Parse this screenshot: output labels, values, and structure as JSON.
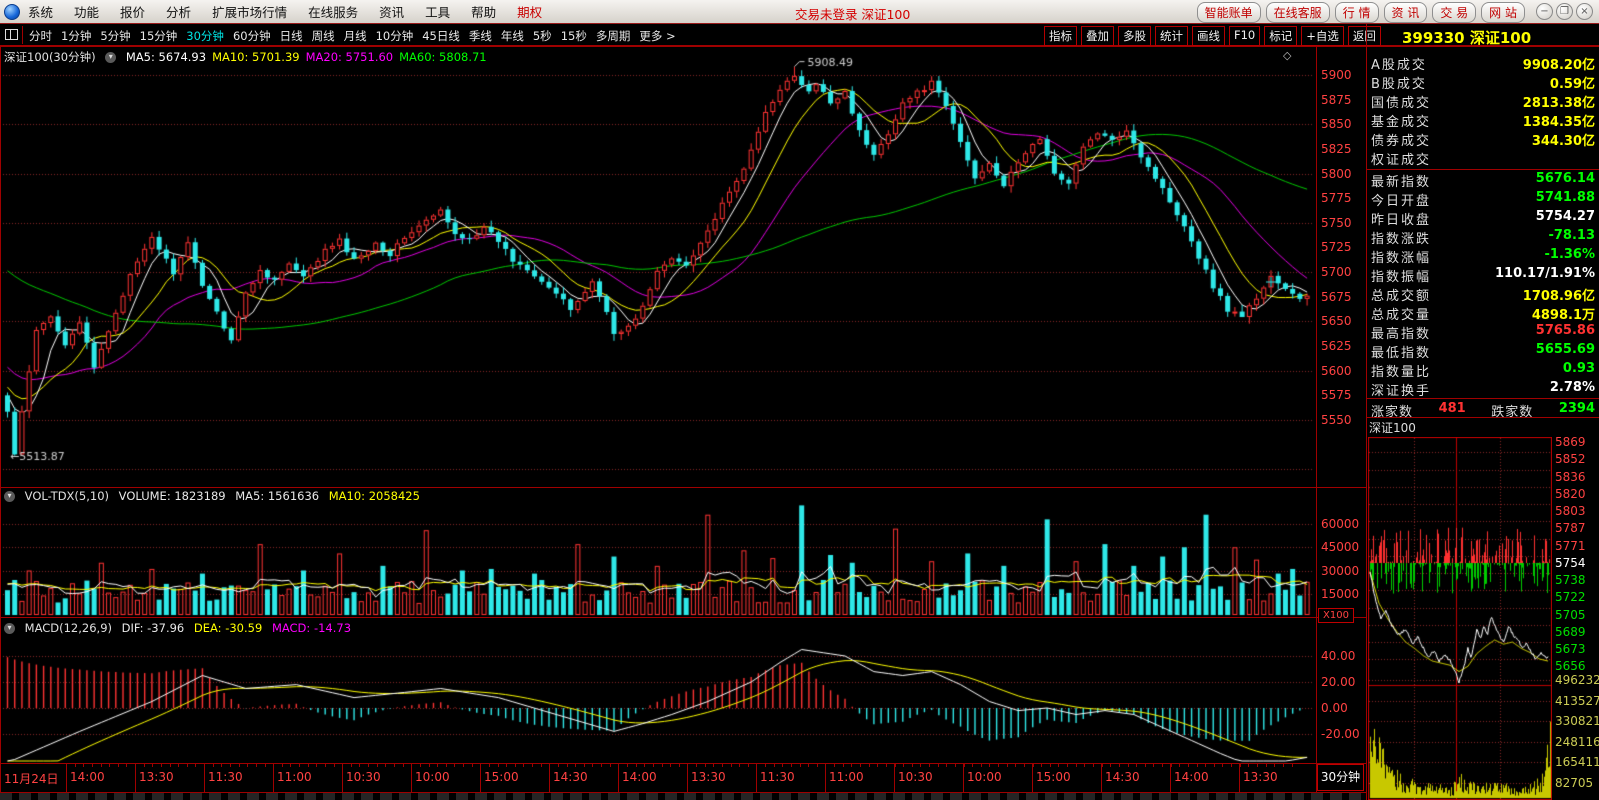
{
  "window": {
    "title_center": "交易未登录 深证100"
  },
  "menubar": {
    "items": [
      "系统",
      "功能",
      "报价",
      "分析",
      "扩展市场行情",
      "在线服务",
      "资讯",
      "工具",
      "帮助"
    ],
    "highlight_item": "期权",
    "action_buttons": [
      "智能账单",
      "在线客服",
      "行 情",
      "资 讯",
      "交 易",
      "网 站"
    ],
    "window_controls": [
      "−",
      "❐",
      "×"
    ]
  },
  "toolbar": {
    "periods": [
      "分时",
      "1分钟",
      "5分钟",
      "15分钟",
      "30分钟",
      "60分钟",
      "日线",
      "周线",
      "月线",
      "10分钟",
      "45日线",
      "季线",
      "年线",
      "5秒",
      "15秒",
      "多周期",
      "更多 >"
    ],
    "active_period": "30分钟",
    "tools": [
      "指标",
      "叠加",
      "多股",
      "统计",
      "画线",
      "F10",
      "标记",
      "+自选",
      "返回"
    ],
    "symbol_code": "399330",
    "symbol_name": "深证100"
  },
  "price_pane": {
    "title": "深证100(30分钟)",
    "mas": [
      {
        "label": "MA5: 5674.93",
        "color": "#ffffff"
      },
      {
        "label": "MA10: 5701.39",
        "color": "#ffff00"
      },
      {
        "label": "MA20: 5751.60",
        "color": "#ff00ff"
      },
      {
        "label": "MA60: 5808.71",
        "color": "#00ff00"
      }
    ],
    "axis": [
      "5900",
      "5875",
      "5850",
      "5825",
      "5800",
      "5775",
      "5750",
      "5725",
      "5700",
      "5675",
      "5650",
      "5625",
      "5600",
      "5575",
      "5550"
    ],
    "corner_icon": "◇"
  },
  "volume_pane": {
    "title": "VOL-TDX(5,10)",
    "volume_label": "VOLUME: 1823189",
    "ma5_label": "MA5: 1561636",
    "ma10_label": "MA10: 2058425",
    "axis": [
      "60000",
      "45000",
      "30000",
      "15000"
    ],
    "unit": "X100"
  },
  "macd_pane": {
    "title": "MACD(12,26,9)",
    "dif_label": "DIF: -37.96",
    "dea_label": "DEA: -30.59",
    "macd_label": "MACD: -14.73",
    "axis": [
      "40.00",
      "20.00",
      "0.00",
      "-20.00"
    ]
  },
  "time_axis": {
    "date": "11月24日",
    "labels": [
      "14:00",
      "13:30",
      "11:30",
      "11:00",
      "10:30",
      "10:00",
      "15:00",
      "14:30",
      "14:00",
      "13:30",
      "11:30",
      "11:00",
      "10:30",
      "10:00",
      "15:00",
      "14:30",
      "14:00",
      "13:30"
    ],
    "period_label": "30分钟"
  },
  "right_panel": {
    "section1": [
      {
        "label": "A股成交",
        "value": "9908.20亿",
        "color": "#ffff00"
      },
      {
        "label": "B股成交",
        "value": "0.59亿",
        "color": "#ffff00"
      },
      {
        "label": "国债成交",
        "value": "2813.38亿",
        "color": "#ffff00"
      },
      {
        "label": "基金成交",
        "value": "1384.35亿",
        "color": "#ffff00"
      },
      {
        "label": "债券成交",
        "value": "344.30亿",
        "color": "#ffff00"
      },
      {
        "label": "权证成交",
        "value": "",
        "color": "#ffff00"
      }
    ],
    "section2": [
      {
        "label": "最新指数",
        "value": "5676.14",
        "color": "#00ff00"
      },
      {
        "label": "今日开盘",
        "value": "5741.88",
        "color": "#00ff00"
      },
      {
        "label": "昨日收盘",
        "value": "5754.27",
        "color": "#ffffff"
      },
      {
        "label": "指数涨跌",
        "value": "-78.13",
        "color": "#00ff00"
      },
      {
        "label": "指数涨幅",
        "value": "-1.36%",
        "color": "#00ff00"
      },
      {
        "label": "指数振幅",
        "value": "110.17/1.91%",
        "color": "#ffffff"
      },
      {
        "label": "总成交额",
        "value": "1708.96亿",
        "color": "#ffff00"
      },
      {
        "label": "总成交量",
        "value": "4898.1万",
        "color": "#ffff00"
      },
      {
        "label": "最高指数",
        "value": "5765.86",
        "color": "#ff3232"
      },
      {
        "label": "最低指数",
        "value": "5655.69",
        "color": "#00ff00"
      },
      {
        "label": "指数量比",
        "value": "0.93",
        "color": "#00ff00"
      },
      {
        "label": "深证换手",
        "value": "2.78%",
        "color": "#ffffff"
      }
    ],
    "adv_label": "涨家数",
    "adv_value": "481",
    "dec_label": "跌家数",
    "dec_value": "2394",
    "mini_title": "深证100"
  },
  "colors": {
    "up": "#ff3232",
    "down": "#2ee8e8",
    "grid": "#8b2525",
    "frame": "#a00000",
    "ma5": "#ffffff",
    "ma10": "#ffff00",
    "ma20": "#e000e0",
    "ma60": "#00c800",
    "axis_text": "#ff4242",
    "mini_vol": "#c8c800"
  },
  "chart_data": {
    "type": "candlestick",
    "symbol": "深证100",
    "period": "30分钟",
    "ma_values": {
      "MA5": 5674.93,
      "MA10": 5701.39,
      "MA20": 5751.6,
      "MA60": 5808.71
    },
    "price_axis": [
      5900,
      5875,
      5850,
      5825,
      5800,
      5775,
      5750,
      5725,
      5700,
      5675,
      5650,
      5625,
      5600,
      5575,
      5550
    ],
    "high_annotation": 5908.49,
    "low_annotation": 5513.87,
    "last_close": 5676.14,
    "n_candles": 181,
    "close_waypoints": [
      [
        0,
        5558
      ],
      [
        1,
        5515
      ],
      [
        4,
        5640
      ],
      [
        6,
        5655
      ],
      [
        8,
        5628
      ],
      [
        10,
        5650
      ],
      [
        12,
        5602
      ],
      [
        15,
        5660
      ],
      [
        17,
        5696
      ],
      [
        19,
        5722
      ],
      [
        20,
        5736
      ],
      [
        23,
        5700
      ],
      [
        25,
        5728
      ],
      [
        27,
        5688
      ],
      [
        30,
        5645
      ],
      [
        31,
        5632
      ],
      [
        33,
        5678
      ],
      [
        35,
        5702
      ],
      [
        37,
        5692
      ],
      [
        39,
        5708
      ],
      [
        41,
        5694
      ],
      [
        44,
        5722
      ],
      [
        46,
        5732
      ],
      [
        48,
        5712
      ],
      [
        51,
        5730
      ],
      [
        53,
        5718
      ],
      [
        55,
        5736
      ],
      [
        58,
        5752
      ],
      [
        60,
        5762
      ],
      [
        62,
        5738
      ],
      [
        64,
        5735
      ],
      [
        66,
        5744
      ],
      [
        68,
        5732
      ],
      [
        70,
        5712
      ],
      [
        72,
        5704
      ],
      [
        74,
        5692
      ],
      [
        76,
        5678
      ],
      [
        78,
        5662
      ],
      [
        81,
        5690
      ],
      [
        83,
        5662
      ],
      [
        84,
        5636
      ],
      [
        86,
        5644
      ],
      [
        88,
        5665
      ],
      [
        90,
        5700
      ],
      [
        92,
        5714
      ],
      [
        94,
        5708
      ],
      [
        97,
        5742
      ],
      [
        99,
        5768
      ],
      [
        101,
        5792
      ],
      [
        103,
        5822
      ],
      [
        105,
        5862
      ],
      [
        107,
        5887
      ],
      [
        109,
        5898
      ],
      [
        111,
        5882
      ],
      [
        112,
        5890
      ],
      [
        114,
        5872
      ],
      [
        116,
        5884
      ],
      [
        118,
        5842
      ],
      [
        120,
        5818
      ],
      [
        122,
        5842
      ],
      [
        124,
        5872
      ],
      [
        126,
        5882
      ],
      [
        128,
        5892
      ],
      [
        130,
        5868
      ],
      [
        132,
        5832
      ],
      [
        134,
        5795
      ],
      [
        136,
        5812
      ],
      [
        138,
        5788
      ],
      [
        141,
        5822
      ],
      [
        143,
        5836
      ],
      [
        145,
        5798
      ],
      [
        147,
        5792
      ],
      [
        149,
        5826
      ],
      [
        151,
        5842
      ],
      [
        153,
        5832
      ],
      [
        155,
        5846
      ],
      [
        157,
        5818
      ],
      [
        159,
        5796
      ],
      [
        161,
        5772
      ],
      [
        163,
        5748
      ],
      [
        165,
        5716
      ],
      [
        167,
        5686
      ],
      [
        169,
        5662
      ],
      [
        171,
        5656
      ],
      [
        173,
        5674
      ],
      [
        175,
        5696
      ],
      [
        177,
        5682
      ],
      [
        179,
        5672
      ],
      [
        180,
        5676.14
      ]
    ],
    "pre_close_waypoints": [
      [
        0,
        5850
      ],
      [
        30,
        5705
      ],
      [
        50,
        5600
      ],
      [
        59,
        5575
      ]
    ],
    "fixed": {
      "high_idx": 109,
      "high": 5908.49,
      "low_idx": 1,
      "low": 5513.87,
      "low2_idx": 171,
      "low2": 5655.69
    },
    "volume": {
      "current": 1823189,
      "ma5": 1561636,
      "ma10": 2058425,
      "axis": [
        60000,
        45000,
        30000,
        15000
      ],
      "unit": "X100",
      "base_min": 9000,
      "base_max": 24000,
      "spikes": [
        [
          3,
          30000
        ],
        [
          13,
          35000
        ],
        [
          20,
          31000
        ],
        [
          27,
          28000
        ],
        [
          35,
          47000
        ],
        [
          41,
          30000
        ],
        [
          46,
          41000
        ],
        [
          52,
          33000
        ],
        [
          58,
          56000
        ],
        [
          63,
          30000
        ],
        [
          67,
          31000
        ],
        [
          73,
          28000
        ],
        [
          79,
          47000
        ],
        [
          84,
          39000
        ],
        [
          90,
          33000
        ],
        [
          97,
          66000
        ],
        [
          102,
          43000
        ],
        [
          106,
          38000
        ],
        [
          110,
          72000
        ],
        [
          114,
          40000
        ],
        [
          117,
          35000
        ],
        [
          123,
          57000
        ],
        [
          128,
          36000
        ],
        [
          133,
          41000
        ],
        [
          138,
          33000
        ],
        [
          144,
          63000
        ],
        [
          148,
          36000
        ],
        [
          152,
          47000
        ],
        [
          156,
          33000
        ],
        [
          160,
          39000
        ],
        [
          163,
          45000
        ],
        [
          166,
          66000
        ],
        [
          170,
          45000
        ],
        [
          173,
          37000
        ],
        [
          176,
          28000
        ],
        [
          178,
          31000
        ]
      ]
    },
    "macd": {
      "dif": -37.96,
      "dea": -30.59,
      "hist": -14.73,
      "axis": [
        40,
        20,
        0,
        -20
      ],
      "dea_seed": -65,
      "dea_alpha": 0.15,
      "dif_waypoints": [
        [
          0,
          -42
        ],
        [
          10,
          -18
        ],
        [
          20,
          5
        ],
        [
          27,
          25
        ],
        [
          33,
          15
        ],
        [
          40,
          18
        ],
        [
          48,
          8
        ],
        [
          55,
          12
        ],
        [
          60,
          15
        ],
        [
          68,
          8
        ],
        [
          76,
          -5
        ],
        [
          84,
          -18
        ],
        [
          88,
          -12
        ],
        [
          92,
          -5
        ],
        [
          97,
          5
        ],
        [
          103,
          20
        ],
        [
          107,
          35
        ],
        [
          110,
          45
        ],
        [
          116,
          40
        ],
        [
          120,
          28
        ],
        [
          124,
          25
        ],
        [
          128,
          28
        ],
        [
          132,
          18
        ],
        [
          136,
          5
        ],
        [
          140,
          -2
        ],
        [
          144,
          0
        ],
        [
          148,
          -5
        ],
        [
          152,
          -2
        ],
        [
          156,
          -5
        ],
        [
          160,
          -15
        ],
        [
          164,
          -25
        ],
        [
          168,
          -35
        ],
        [
          172,
          -44
        ],
        [
          176,
          -42
        ],
        [
          180,
          -37.96
        ]
      ]
    },
    "minute": {
      "prev_close": 5754.27,
      "price_axis": [
        5869,
        5852,
        5836,
        5820,
        5803,
        5787,
        5771,
        5754,
        5738,
        5722,
        5705,
        5689,
        5673,
        5656
      ],
      "vol_axis": [
        496232,
        413527,
        330821,
        248116,
        165411,
        82705
      ],
      "close_waypoints": [
        [
          0,
          5746
        ],
        [
          0.03,
          5720
        ],
        [
          0.06,
          5701
        ],
        [
          0.09,
          5709
        ],
        [
          0.12,
          5695
        ],
        [
          0.16,
          5686
        ],
        [
          0.2,
          5691
        ],
        [
          0.24,
          5677
        ],
        [
          0.27,
          5684
        ],
        [
          0.3,
          5673
        ],
        [
          0.33,
          5664
        ],
        [
          0.36,
          5671
        ],
        [
          0.39,
          5661
        ],
        [
          0.42,
          5668
        ],
        [
          0.45,
          5661
        ],
        [
          0.48,
          5650
        ],
        [
          0.5,
          5641
        ],
        [
          0.53,
          5657
        ],
        [
          0.55,
          5673
        ],
        [
          0.57,
          5664
        ],
        [
          0.6,
          5691
        ],
        [
          0.62,
          5681
        ],
        [
          0.64,
          5694
        ],
        [
          0.66,
          5686
        ],
        [
          0.68,
          5704
        ],
        [
          0.7,
          5695
        ],
        [
          0.72,
          5687
        ],
        [
          0.75,
          5679
        ],
        [
          0.78,
          5695
        ],
        [
          0.8,
          5687
        ],
        [
          0.83,
          5681
        ],
        [
          0.86,
          5673
        ],
        [
          0.88,
          5678
        ],
        [
          0.9,
          5671
        ],
        [
          0.93,
          5663
        ],
        [
          0.96,
          5669
        ],
        [
          1,
          5664
        ]
      ],
      "avg_waypoints": [
        [
          0,
          5746
        ],
        [
          0.05,
          5716
        ],
        [
          0.1,
          5701
        ],
        [
          0.15,
          5689
        ],
        [
          0.2,
          5679
        ],
        [
          0.25,
          5673
        ],
        [
          0.3,
          5666
        ],
        [
          0.35,
          5661
        ],
        [
          0.4,
          5659
        ],
        [
          0.45,
          5657
        ],
        [
          0.5,
          5651
        ],
        [
          0.55,
          5656
        ],
        [
          0.6,
          5668
        ],
        [
          0.65,
          5675
        ],
        [
          0.7,
          5681
        ],
        [
          0.75,
          5677
        ],
        [
          0.8,
          5679
        ],
        [
          0.85,
          5673
        ],
        [
          0.9,
          5669
        ],
        [
          0.95,
          5663
        ],
        [
          1,
          5661
        ]
      ],
      "vol_waypoints": [
        [
          0,
          480000
        ],
        [
          0.04,
          300000
        ],
        [
          0.1,
          160000
        ],
        [
          0.2,
          110000
        ],
        [
          0.3,
          90000
        ],
        [
          0.45,
          70000
        ],
        [
          0.5,
          120000
        ],
        [
          0.6,
          80000
        ],
        [
          0.7,
          90000
        ],
        [
          0.8,
          70000
        ],
        [
          0.9,
          80000
        ],
        [
          0.97,
          130000
        ],
        [
          1,
          430000
        ]
      ]
    }
  }
}
